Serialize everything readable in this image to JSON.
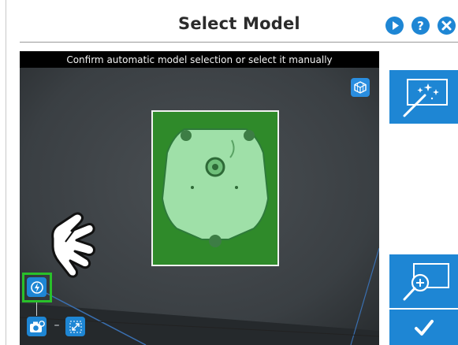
{
  "header": {
    "title": "Select Model",
    "buttons": [
      {
        "name": "play-icon"
      },
      {
        "name": "help-icon",
        "glyph": "?"
      },
      {
        "name": "close-icon"
      }
    ]
  },
  "viewport": {
    "banner": "Confirm automatic model selection or select it manually",
    "cube_icon": "3d-view-icon"
  },
  "tools": {
    "auto_detect_icon": "auto-detect-icon",
    "camera_settings_icon": "camera-settings-icon",
    "expand_icon": "expand-icon",
    "connector": "–"
  },
  "side": {
    "auto_select_icon": "magic-wand-icon",
    "zoom_select_icon": "zoom-in-icon",
    "confirm_icon": "checkmark-icon"
  },
  "colors": {
    "accent": "#1e86d4",
    "highlight": "#29c02a",
    "model_fill": "#2f8a2a",
    "banner_bg": "#000000"
  }
}
